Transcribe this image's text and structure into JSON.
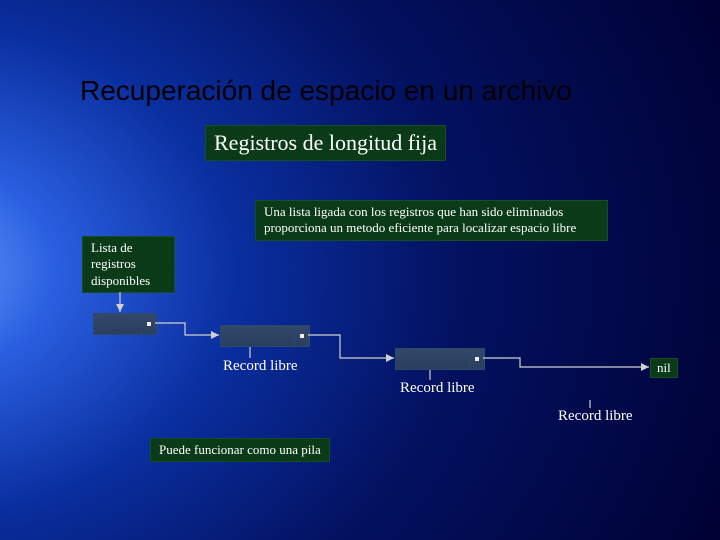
{
  "title": "Recuperación de espacio en un archivo",
  "subtitle": "Registros de longitud fija",
  "description": "Una lista ligada con los registros que han sido eliminados proporciona un metodo eficiente para localizar espacio libre",
  "list_head_label": "Lista de registros disponibles",
  "records": [
    {
      "label": "Record libre"
    },
    {
      "label": "Record libre"
    },
    {
      "label": "Record libre"
    }
  ],
  "nil_label": "nil",
  "footnote": "Puede funcionar como una pila",
  "colors": {
    "box_bg": "#0b3a18",
    "record_bg": "#2a3f5f"
  }
}
